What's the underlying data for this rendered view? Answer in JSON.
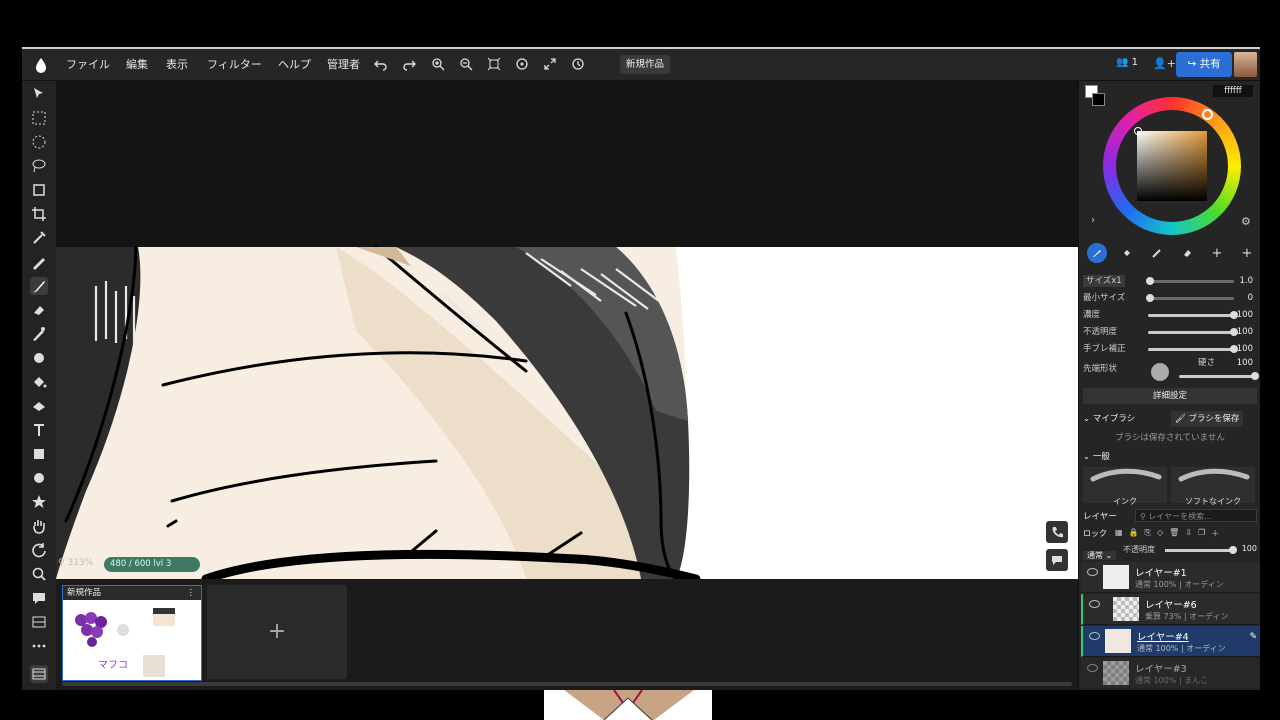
{
  "menu": {
    "file": "ファイル",
    "edit": "編集",
    "view": "表示",
    "filter": "フィルター",
    "help": "ヘルプ",
    "admin": "管理者"
  },
  "document_tab": "新規作品",
  "header": {
    "user_count": "1",
    "share_label": "共有"
  },
  "canvas": {
    "zoom": "313%",
    "brush_info": "480 / 600  lvl 3"
  },
  "artboards": {
    "active_title": "新規作品",
    "add_label": "+"
  },
  "color": {
    "hex": "ffffff",
    "hue_accent": "#e29a38"
  },
  "brush_tabs": [
    "1",
    "2",
    "3",
    "4",
    "5",
    "6"
  ],
  "settings": {
    "size_label": "サイズx1",
    "size_value": "1.0",
    "min_size_label": "最小サイズ",
    "min_size_value": "0",
    "density_label": "濃度",
    "density_value": "100",
    "opacity_label": "不透明度",
    "opacity_value": "100",
    "stabilizer_label": "手ブレ補正",
    "stabilizer_value": "100",
    "tip_shape_label": "先端形状",
    "hardness_label": "硬さ",
    "hardness_value": "100",
    "detail_button": "詳細設定"
  },
  "my_brush": {
    "title": "マイブラシ",
    "save_button": "ブラシを保存",
    "empty_text": "ブラシは保存されていません"
  },
  "general": {
    "title": "一般",
    "presets": [
      "インク",
      "ソフトなインク"
    ]
  },
  "layers": {
    "title": "レイヤー",
    "search_placeholder": "レイヤーを検索...",
    "lock_label": "ロック",
    "blend_mode": "通常",
    "opacity_label": "不透明度",
    "opacity_value": "100",
    "items": [
      {
        "name": "レイヤー#1",
        "sub": "通常 100% | オーディン"
      },
      {
        "name": "レイヤー#6",
        "sub": "乗算 73% | オーディン"
      },
      {
        "name": "レイヤー#4",
        "sub": "通常 100% | オーディン"
      },
      {
        "name": "レイヤー#3",
        "sub": "通常 100% | まんこ"
      }
    ]
  },
  "colors": {
    "accent": "#2b6fd6",
    "panel": "#252525",
    "canvas_bg": "#141414",
    "selected_layer": "#203a6a"
  }
}
